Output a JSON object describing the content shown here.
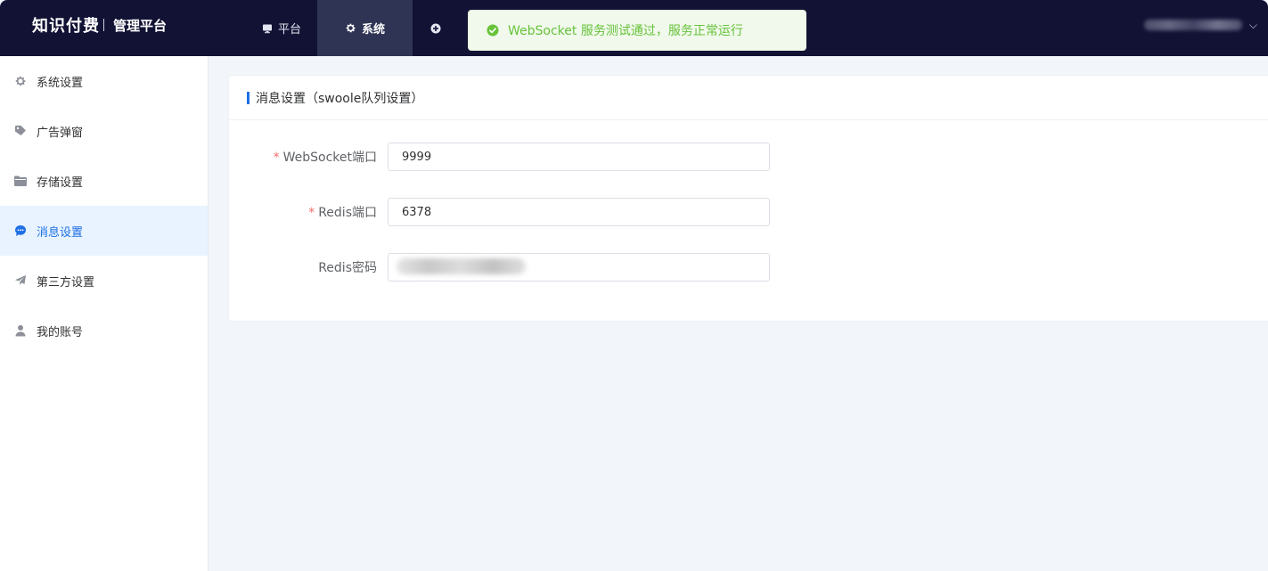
{
  "header": {
    "brand_main": "知识付费",
    "brand_sub": "管理平台",
    "tabs": [
      {
        "label": "平台",
        "icon": "monitor-icon",
        "active": false
      },
      {
        "label": "系统",
        "icon": "gear-icon",
        "active": true
      },
      {
        "label": "",
        "icon": "plus-circle-icon",
        "active": false
      }
    ],
    "user_caret": "⌵"
  },
  "toast": {
    "type": "success",
    "icon": "check-circle-icon",
    "message": "WebSocket 服务测试通过，服务正常运行",
    "color": "#67c23a"
  },
  "sidebar": {
    "items": [
      {
        "label": "系统设置",
        "icon": "gear-icon",
        "active": false
      },
      {
        "label": "广告弹窗",
        "icon": "tag-icon",
        "active": false
      },
      {
        "label": "存储设置",
        "icon": "folder-icon",
        "active": false
      },
      {
        "label": "消息设置",
        "icon": "chat-bubble-icon",
        "active": true
      },
      {
        "label": "第三方设置",
        "icon": "paper-plane-icon",
        "active": false
      },
      {
        "label": "我的账号",
        "icon": "user-icon",
        "active": false
      }
    ]
  },
  "card": {
    "title": "消息设置（swoole队列设置）",
    "fields": [
      {
        "label": "WebSocket端口",
        "required": true,
        "value": "9999"
      },
      {
        "label": "Redis端口",
        "required": true,
        "value": "6378"
      },
      {
        "label": "Redis密码",
        "required": false,
        "value": ""
      }
    ]
  },
  "colors": {
    "header_bg": "#121235",
    "active_tab_bg": "#2f3354",
    "accent": "#1f6fe5",
    "sidebar_active_bg": "#e8f3ff",
    "required": "#f56c6c"
  }
}
